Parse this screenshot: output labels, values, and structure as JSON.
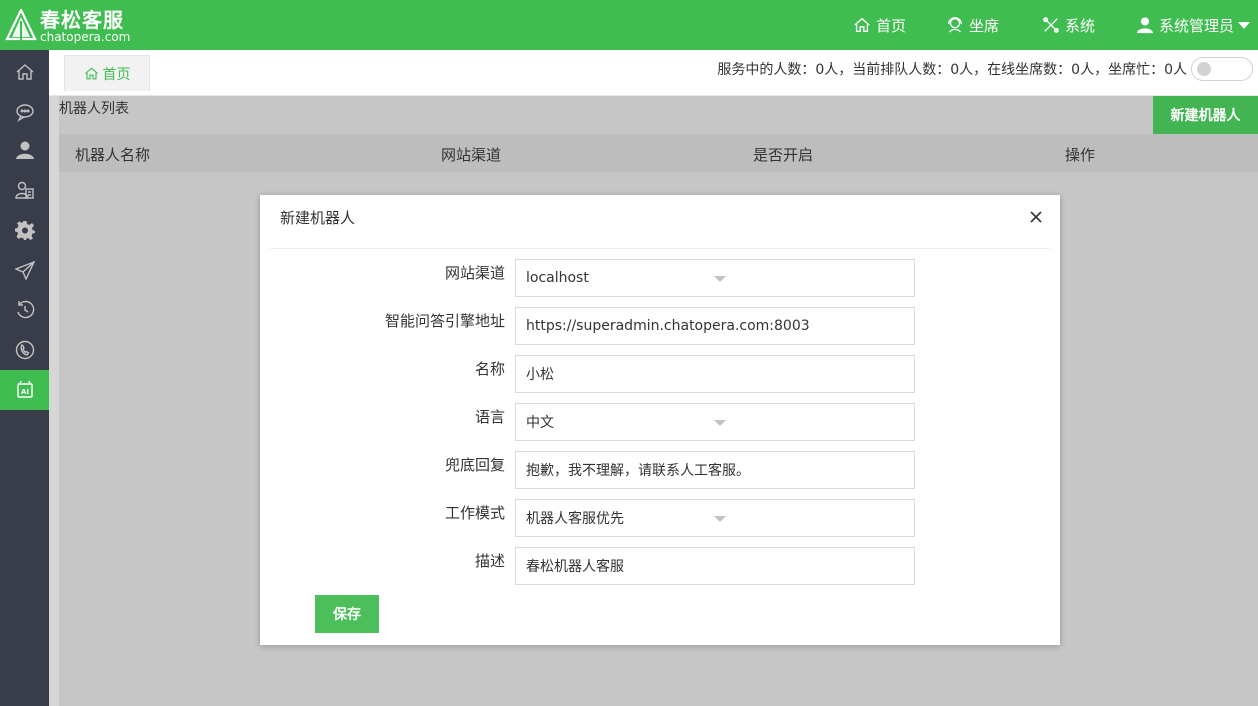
{
  "app": {
    "logo_cn": "春松客服",
    "logo_en": "chatopera.com",
    "colors": {
      "brand": "#3fbd50",
      "sidebar": "#393d49",
      "button": "#42b552"
    }
  },
  "nav": {
    "home": "首页",
    "agent": "坐席",
    "system": "系统",
    "user": "系统管理员",
    "icons": [
      "home-icon",
      "headset-icon",
      "tools-icon",
      "user-icon"
    ]
  },
  "sidebar": {
    "items": [
      {
        "icon": "home-icon",
        "active": false
      },
      {
        "icon": "chat-bubbles-icon",
        "active": false
      },
      {
        "icon": "person-icon",
        "active": false
      },
      {
        "icon": "contact-card-icon",
        "active": false
      },
      {
        "icon": "gear-icon",
        "active": false
      },
      {
        "icon": "paper-plane-icon",
        "active": false
      },
      {
        "icon": "history-icon",
        "active": false
      },
      {
        "icon": "phone-icon",
        "active": false
      },
      {
        "icon": "ai-robot-icon",
        "active": true
      }
    ]
  },
  "tabs": [
    {
      "label": "首页"
    }
  ],
  "status": {
    "text": "服务中的人数：0人，当前排队人数：0人，在线坐席数：0人，坐席忙：0人",
    "busy_toggle": false
  },
  "page": {
    "list_title": "机器人列表",
    "new_button": "新建机器人",
    "columns": [
      "机器人名称",
      "网站渠道",
      "是否开启",
      "操作"
    ]
  },
  "modal": {
    "title": "新建机器人",
    "fields": [
      {
        "label": "网站渠道",
        "value": "localhost",
        "type": "select"
      },
      {
        "label": "智能问答引擎地址",
        "value": "https://superadmin.chatopera.com:8003",
        "type": "text"
      },
      {
        "label": "名称",
        "value": "小松",
        "type": "text"
      },
      {
        "label": "语言",
        "value": "中文",
        "type": "select"
      },
      {
        "label": "兜底回复",
        "value": "抱歉，我不理解，请联系人工客服。",
        "type": "text"
      },
      {
        "label": "工作模式",
        "value": "机器人客服优先",
        "type": "select"
      },
      {
        "label": "描述",
        "value": "春松机器人客服",
        "type": "text"
      }
    ],
    "save_label": "保存"
  }
}
